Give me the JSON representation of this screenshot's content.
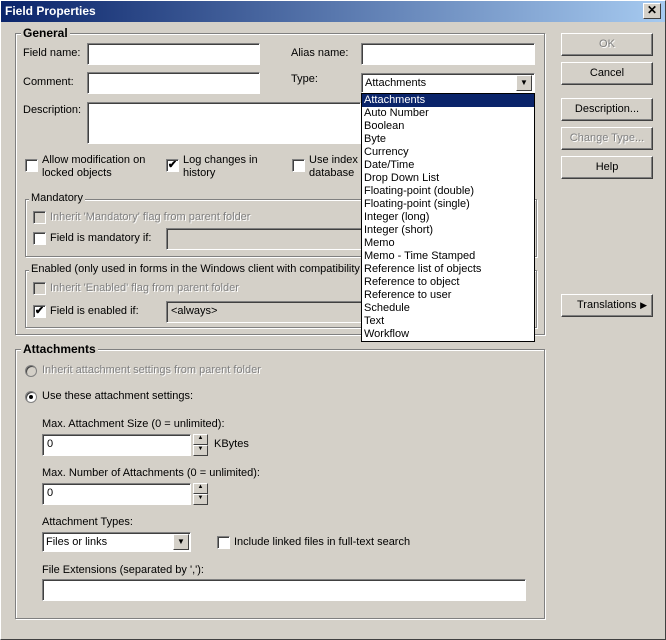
{
  "window": {
    "title": "Field Properties",
    "close_label": "✕"
  },
  "general": {
    "title": "General",
    "field_name_label": "Field name:",
    "field_name_value": "",
    "alias_name_label": "Alias name:",
    "alias_name_value": "",
    "comment_label": "Comment:",
    "comment_value": "",
    "type_label": "Type:",
    "type_value": "Attachments",
    "description_label": "Description:",
    "allow_mod_label_1": "Allow modification on",
    "allow_mod_label_2": "locked objects",
    "log_changes_label_1": "Log changes in",
    "log_changes_label_2": "history",
    "log_changes_check": "✔",
    "use_index_label_1": "Use index i",
    "use_index_label_2": "database"
  },
  "mandatory": {
    "title": "Mandatory",
    "inherit_label": "Inherit 'Mandatory' flag from parent folder",
    "field_mandatory_label": "Field is mandatory if:"
  },
  "enabled": {
    "title": "Enabled (only used in forms in the Windows client with compatibility le",
    "inherit_label": "Inherit 'Enabled' flag from parent folder",
    "field_enabled_label": "Field is enabled if:",
    "field_enabled_check": "✔",
    "condition_value": "<always>"
  },
  "type_dropdown": {
    "options": [
      "Attachments",
      "Auto Number",
      "Boolean",
      "Byte",
      "Currency",
      "Date/Time",
      "Drop Down List",
      "Floating-point (double)",
      "Floating-point (single)",
      "Integer (long)",
      "Integer (short)",
      "Memo",
      "Memo - Time Stamped",
      "Reference list of objects",
      "Reference to object",
      "Reference to user",
      "Schedule",
      "Text",
      "Workflow"
    ],
    "selected": "Attachments"
  },
  "buttons": {
    "ok": "OK",
    "cancel": "Cancel",
    "description": "Description...",
    "change_type": "Change Type...",
    "help": "Help",
    "translations": "Translations"
  },
  "attachments": {
    "title": "Attachments",
    "inherit_label": "Inherit attachment settings from parent folder",
    "use_these_label": "Use these attachment settings:",
    "max_size_label": "Max. Attachment Size (0 = unlimited):",
    "max_size_value": "0",
    "max_size_unit": "KBytes",
    "max_number_label": "Max. Number of Attachments (0 = unlimited):",
    "max_number_value": "0",
    "types_label": "Attachment Types:",
    "types_value": "Files or links",
    "include_linked_label": "Include linked files in full-text search",
    "extensions_label": "File Extensions (separated by ','):",
    "extensions_value": ""
  }
}
